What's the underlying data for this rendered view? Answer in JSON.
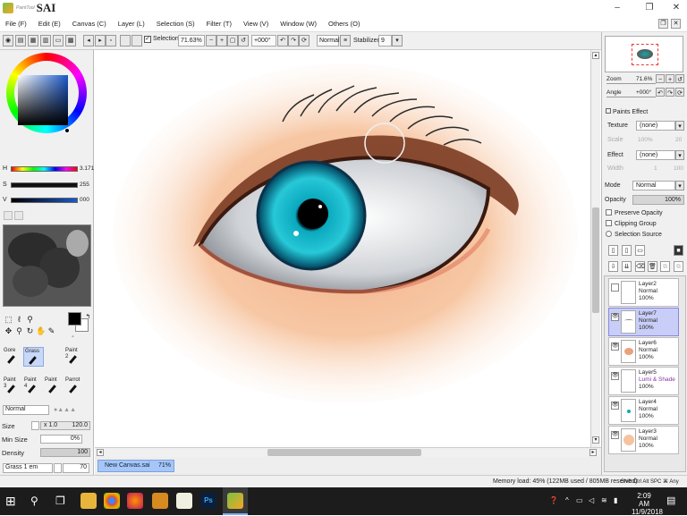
{
  "app": {
    "name": "SAI",
    "subtitle": "PaintTool"
  },
  "window_controls": [
    "–",
    "❐",
    "✕"
  ],
  "menu": [
    "File (F)",
    "Edit (E)",
    "Canvas (C)",
    "Layer (L)",
    "Selection (S)",
    "Filter (T)",
    "View (V)",
    "Window (W)",
    "Others (O)"
  ],
  "toolbar": {
    "selection_label": "Selection",
    "zoom": "71.63%",
    "rotation": "+000°",
    "blend": "Normal",
    "stabilizer_label": "Stabilizer",
    "stabilizer_value": "9"
  },
  "color": {
    "h_label": "H",
    "h_value": "3.171",
    "s_label": "S",
    "s_value": "255",
    "v_label": "V",
    "v_value": "000",
    "selected_hue": "#1a5acc"
  },
  "brushes": [
    {
      "name": "Gore",
      "size": ""
    },
    {
      "name": "Grass",
      "size": ""
    },
    {
      "name": "Paint",
      "size": "2"
    },
    {
      "name": "Paint",
      "size": "3"
    },
    {
      "name": "Paint",
      "size": "4"
    },
    {
      "name": "Paint",
      "size": ""
    },
    {
      "name": "Parrot",
      "size": ""
    }
  ],
  "brush_props": {
    "mode": "Normal",
    "size_label": "Size",
    "size_mult": "x 1.0",
    "size_value": "120.0",
    "minsize_label": "Min Size",
    "minsize_value": "0%",
    "density_label": "Density",
    "density_value": "100",
    "texture": "Grass 1 em",
    "texture_value": "70"
  },
  "document_tab": {
    "name": "New Canvas.sai",
    "zoom": "71%"
  },
  "navigator": {
    "zoom_label": "Zoom",
    "zoom_value": "71.6%",
    "angle_label": "Angle",
    "angle_value": "+000°"
  },
  "paints_effect": {
    "title": "Paints Effect",
    "texture_label": "Texture",
    "texture_value": "(none)",
    "scale_label": "Scale",
    "scale_value": "100%",
    "scale_num": "20",
    "effect_label": "Effect",
    "effect_value": "(none)",
    "width_label": "Width",
    "width_value": "1",
    "width_num": "100"
  },
  "layer_props": {
    "mode_label": "Mode",
    "mode_value": "Normal",
    "opacity_label": "Opacity",
    "opacity_value": "100%",
    "preserve_opacity": "Preserve Opacity",
    "clipping_group": "Clipping Group",
    "selection_source": "Selection Source"
  },
  "layers": [
    {
      "name": "Layer2",
      "mode": "Normal",
      "opacity": "100%",
      "selected": false
    },
    {
      "name": "Layer7",
      "mode": "Normal",
      "opacity": "100%",
      "selected": true
    },
    {
      "name": "Layer6",
      "mode": "Normal",
      "opacity": "100%",
      "selected": false
    },
    {
      "name": "Layer5",
      "mode": "Lumi & Shade",
      "opacity": "100%",
      "selected": false
    },
    {
      "name": "Layer4",
      "mode": "Normal",
      "opacity": "100%",
      "selected": false
    },
    {
      "name": "Layer3",
      "mode": "Normal",
      "opacity": "100%",
      "selected": false
    }
  ],
  "status": {
    "memory": "Memory load: 45% (122MB used / 805MB reserved)",
    "keys": "Shift Ctrl Alt SPC ⌘ Any"
  },
  "taskbar": {
    "time": "2:09 AM",
    "date": "11/9/2018"
  }
}
